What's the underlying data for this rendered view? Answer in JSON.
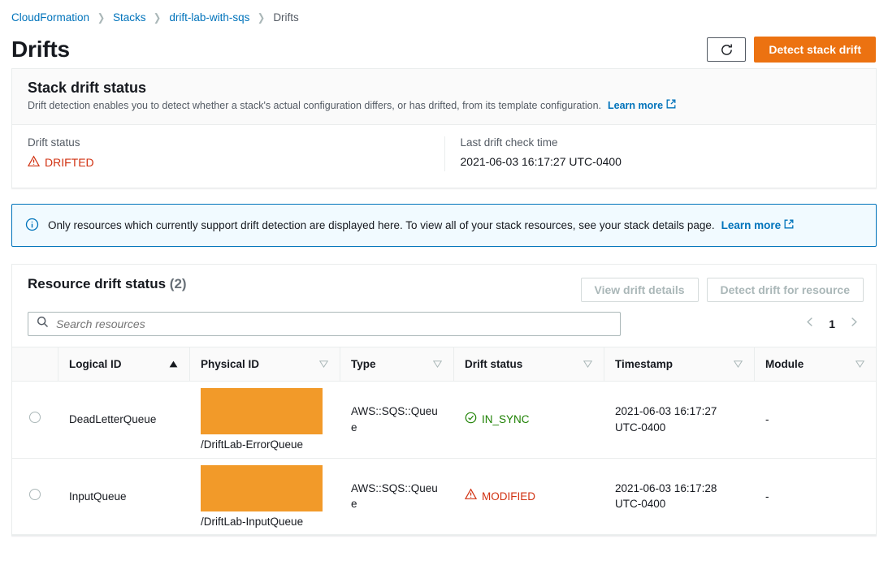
{
  "breadcrumb": {
    "items": [
      {
        "label": "CloudFormation",
        "link": true
      },
      {
        "label": "Stacks",
        "link": true
      },
      {
        "label": "drift-lab-with-sqs",
        "link": true
      },
      {
        "label": "Drifts",
        "link": false
      }
    ],
    "separator": "❯"
  },
  "header": {
    "title": "Drifts",
    "refresh_icon": "refresh-icon",
    "detect_stack_drift_label": "Detect stack drift",
    "primary_color": "#ec7211"
  },
  "stack_drift_status": {
    "heading": "Stack drift status",
    "description": "Drift detection enables you to detect whether a stack's actual configuration differs, or has drifted, from its template configuration.",
    "learn_more_label": "Learn more",
    "drift_status_label": "Drift status",
    "drift_status_value": "DRIFTED",
    "drift_status_color": "#d13212",
    "last_check_label": "Last drift check time",
    "last_check_value": "2021-06-03 16:17:27 UTC-0400"
  },
  "info_alert": {
    "icon": "info-circle-icon",
    "text": "Only resources which currently support drift detection are displayed here. To view all of your stack resources, see your stack details page.",
    "learn_more_label": "Learn more",
    "border_color": "#0073bb",
    "background_color": "#f1faff"
  },
  "resource_table": {
    "title": "Resource drift status",
    "count": "(2)",
    "view_drift_details_label": "View drift details",
    "detect_drift_for_resource_label": "Detect drift for resource",
    "search_placeholder": "Search resources",
    "search_value": "",
    "search_icon": "search-icon",
    "pagination": {
      "prev_icon": "chevron-left-icon",
      "page": "1",
      "next_icon": "chevron-right-icon"
    },
    "columns": [
      {
        "label": "Logical ID",
        "sort": "ascending"
      },
      {
        "label": "Physical ID",
        "sort": "none"
      },
      {
        "label": "Type",
        "sort": "none"
      },
      {
        "label": "Drift status",
        "sort": "none"
      },
      {
        "label": "Timestamp",
        "sort": "none"
      },
      {
        "label": "Module",
        "sort": "none"
      }
    ],
    "rows": [
      {
        "selected": false,
        "logical_id": "DeadLetterQueue",
        "physical_id_redacted": true,
        "physical_id_suffix": "/DriftLab-ErrorQueue",
        "type": "AWS::SQS::Queue",
        "drift_status": "IN_SYNC",
        "drift_status_color": "#1d8102",
        "drift_status_icon": "check-circle-icon",
        "timestamp": "2021-06-03 16:17:27 UTC-0400",
        "module": "-"
      },
      {
        "selected": false,
        "logical_id": "InputQueue",
        "physical_id_redacted": true,
        "physical_id_suffix": "/DriftLab-InputQueue",
        "type": "AWS::SQS::Queue",
        "drift_status": "MODIFIED",
        "drift_status_color": "#d13212",
        "drift_status_icon": "warning-triangle-icon",
        "timestamp": "2021-06-03 16:17:28 UTC-0400",
        "module": "-"
      }
    ],
    "redaction_color": "#f29a29"
  }
}
